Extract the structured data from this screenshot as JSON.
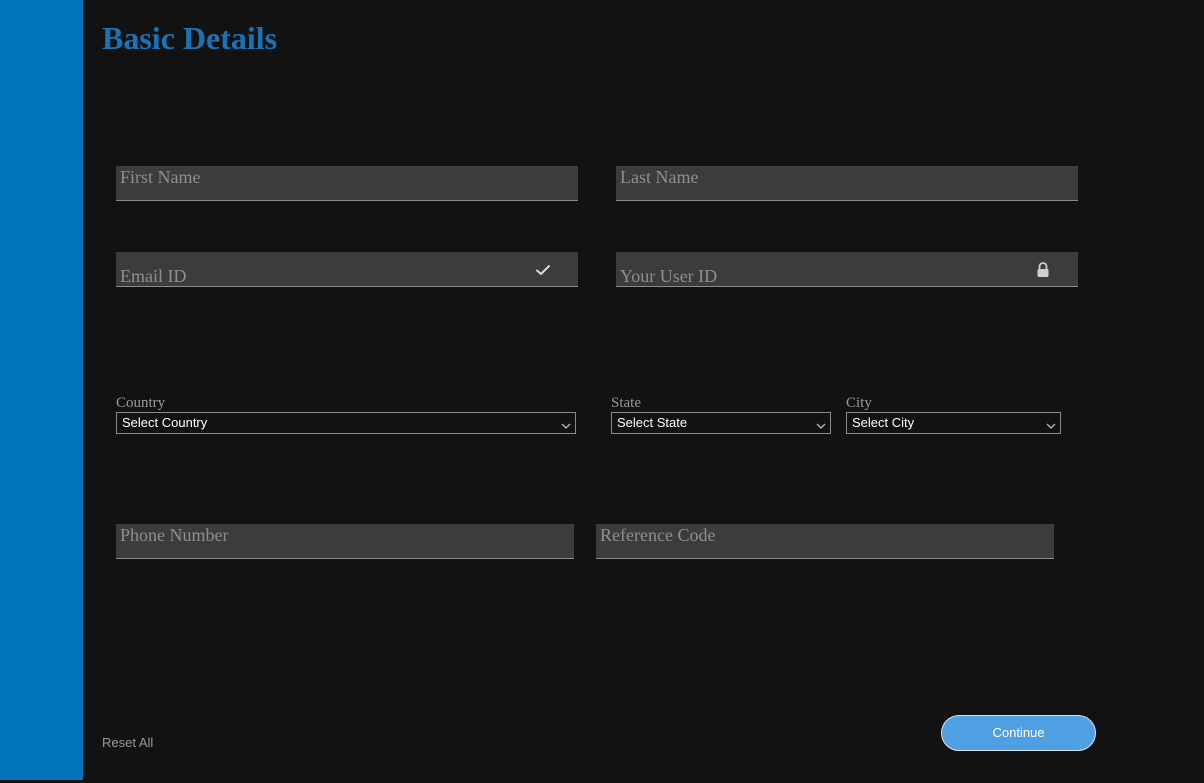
{
  "page": {
    "title": "Basic Details",
    "sidebar_color": "#0074b9",
    "accent_color": "#1a73b9"
  },
  "form": {
    "first_name": {
      "placeholder": "First Name",
      "value": ""
    },
    "last_name": {
      "placeholder": "Last Name",
      "value": ""
    },
    "email": {
      "placeholder": "Email ID",
      "value": "",
      "icon": "checkmark-icon"
    },
    "user_id": {
      "placeholder": "Your User ID",
      "value": "",
      "icon": "lock-icon"
    },
    "country": {
      "label": "Country",
      "selected": "Select Country"
    },
    "state": {
      "label": "State",
      "selected": "Select State"
    },
    "city": {
      "label": "City",
      "selected": "Select City"
    },
    "phone": {
      "placeholder": "Phone Number",
      "value": ""
    },
    "reference": {
      "placeholder": "Reference Code",
      "value": ""
    }
  },
  "actions": {
    "reset_label": "Reset All",
    "continue_label": "Continue",
    "continue_color": "#4f9fe3"
  }
}
